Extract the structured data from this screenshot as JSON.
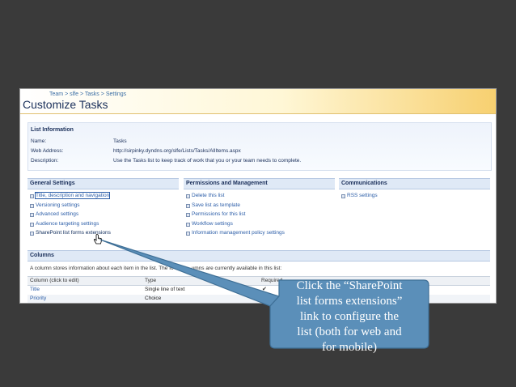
{
  "breadcrumb": [
    "Team",
    "slfe",
    "Tasks",
    "Settings"
  ],
  "breadcrumb_sep": ">",
  "page_title": "Customize Tasks",
  "list_info": {
    "title": "List Information",
    "rows": [
      {
        "label": "Name:",
        "value": "Tasks"
      },
      {
        "label": "Web Address:",
        "value": "http://sirpinky.dyndns.org/slfe/Lists/Tasks/AllItems.aspx"
      },
      {
        "label": "Description:",
        "value": "Use the Tasks list to keep track of work that you or your team needs to complete."
      }
    ]
  },
  "general": {
    "title": "General Settings",
    "items": [
      "Title, description and navigation",
      "Versioning settings",
      "Advanced settings",
      "Audience targeting settings",
      "SharePoint list forms extensions"
    ]
  },
  "permissions": {
    "title": "Permissions and Management",
    "items": [
      "Delete this list",
      "Save list as template",
      "Permissions for this list",
      "Workflow settings",
      "Information management policy settings"
    ]
  },
  "communications": {
    "title": "Communications",
    "items": [
      "RSS settings"
    ]
  },
  "columns": {
    "title": "Columns",
    "desc_start": "A column stores information about each item in the list. The fo",
    "desc_end": "umns are currently available in this list:",
    "headers": [
      "Column (click to edit)",
      "Type",
      "Required"
    ],
    "rows": [
      {
        "name": "Title",
        "type": "Single line of text",
        "required": "✔"
      },
      {
        "name": "Priority",
        "type": "Choice",
        "required": ""
      }
    ]
  },
  "callout": {
    "lines": [
      "Click the “SharePoint",
      "list forms extensions”",
      "link to configure the",
      "list (both for web and",
      "for mobile)"
    ],
    "fill": "#5b8fb9",
    "stroke": "#3e6f96"
  }
}
